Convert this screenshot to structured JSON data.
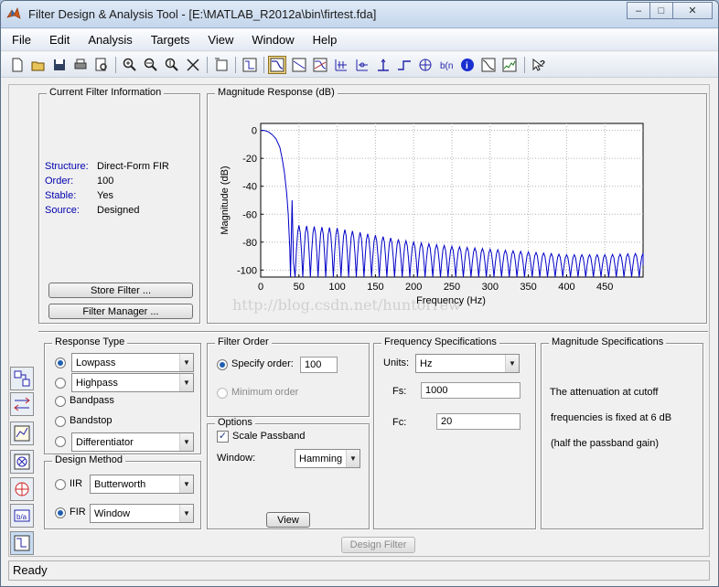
{
  "window": {
    "title": "Filter Design & Analysis Tool  -  [E:\\MATLAB_R2012a\\bin\\firtest.fda]",
    "minimize": "–",
    "maximize": "□",
    "close": "✕"
  },
  "menu": [
    "File",
    "Edit",
    "Analysis",
    "Targets",
    "View",
    "Window",
    "Help"
  ],
  "toolbar": {
    "icons": [
      "new-icon",
      "open-icon",
      "save-icon",
      "print-icon",
      "print-preview-icon",
      "zoom-in-icon",
      "zoom-x-icon",
      "zoom-y-icon",
      "full-view-icon",
      "new-window-icon",
      "filter-specs-icon",
      "magnitude-response-icon",
      "phase-response-icon",
      "magnitude-phase-icon",
      "group-delay-icon",
      "phase-delay-icon",
      "impulse-response-icon",
      "step-response-icon",
      "pole-zero-icon",
      "filter-coefficients-icon",
      "filter-info-icon",
      "magnitude-estimate-icon",
      "round-off-noise-icon",
      "whats-this-icon"
    ]
  },
  "current_filter": {
    "title": "Current Filter Information",
    "rows": [
      {
        "label": "Structure:",
        "value": "Direct-Form FIR"
      },
      {
        "label": "Order:",
        "value": "100"
      },
      {
        "label": "Stable:",
        "value": "Yes"
      },
      {
        "label": "Source:",
        "value": "Designed"
      }
    ],
    "store_button": "Store Filter ...",
    "manager_button": "Filter Manager ..."
  },
  "chart_data": {
    "type": "line",
    "title": "Magnitude Response (dB)",
    "xlabel": "Frequency (Hz)",
    "ylabel": "Magnitude (dB)",
    "xlim": [
      0,
      500
    ],
    "ylim": [
      -105,
      5
    ],
    "xticks": [
      0,
      50,
      100,
      150,
      200,
      250,
      300,
      350,
      400,
      450
    ],
    "yticks": [
      0,
      -20,
      -40,
      -60,
      -80,
      -100
    ],
    "grid": true,
    "series": [
      {
        "color": "#0000c8",
        "passband": {
          "x": [
            0,
            5,
            10,
            15,
            20,
            25,
            28,
            31,
            34,
            36,
            38
          ],
          "y": [
            0,
            -0.1,
            -1,
            -3,
            -6,
            -12,
            -20,
            -30,
            -45,
            -60,
            -85
          ]
        },
        "first_sidelobe_db": -50,
        "sidelobe_start_hz": 40,
        "sidelobe_spacing_hz": 10,
        "sidelobe_peaks_db": {
          "x": [
            50,
            100,
            150,
            200,
            250,
            300,
            350,
            400,
            450,
            500
          ],
          "y": [
            -68,
            -70,
            -75,
            -80,
            -83,
            -85,
            -87,
            -89,
            -89,
            -88
          ]
        },
        "null_floor_db": -105
      }
    ]
  },
  "watermark": "http://blog.csdn.net/huntorrew",
  "response_type": {
    "title": "Response Type",
    "options": [
      {
        "label": "Lowpass",
        "selected": true,
        "dropdown": true
      },
      {
        "label": "Highpass",
        "selected": false,
        "dropdown": true
      },
      {
        "label": "Bandpass",
        "selected": false,
        "dropdown": false
      },
      {
        "label": "Bandstop",
        "selected": false,
        "dropdown": false
      },
      {
        "label": "Differentiator",
        "selected": false,
        "dropdown": true
      }
    ]
  },
  "design_method": {
    "title": "Design Method",
    "iir_label": "IIR",
    "iir_value": "Butterworth",
    "fir_label": "FIR",
    "fir_value": "Window",
    "selected": "FIR"
  },
  "filter_order": {
    "title": "Filter Order",
    "specify_label": "Specify order:",
    "specify_value": "100",
    "minimum_label": "Minimum order"
  },
  "options": {
    "title": "Options",
    "scale_label": "Scale Passband",
    "scale_checked": true,
    "window_label": "Window:",
    "window_value": "Hamming",
    "view_button": "View"
  },
  "frequency_specs": {
    "title": "Frequency Specifications",
    "units_label": "Units:",
    "units_value": "Hz",
    "fs_label": "Fs:",
    "fs_value": "1000",
    "fc_label": "Fc:",
    "fc_value": "20"
  },
  "magnitude_specs": {
    "title": "Magnitude Specifications",
    "line1": "The attenuation at cutoff",
    "line2": "frequencies is fixed at 6 dB",
    "line3": "(half the passband gain)"
  },
  "design_button": "Design Filter",
  "status": "Ready",
  "sidebar_icons": [
    "transform-filter-icon",
    "create-multirate-icon",
    "realize-model-icon",
    "pole-zero-editor-icon",
    "import-filter-icon",
    "export-filter-icon",
    "design-filter-icon"
  ]
}
